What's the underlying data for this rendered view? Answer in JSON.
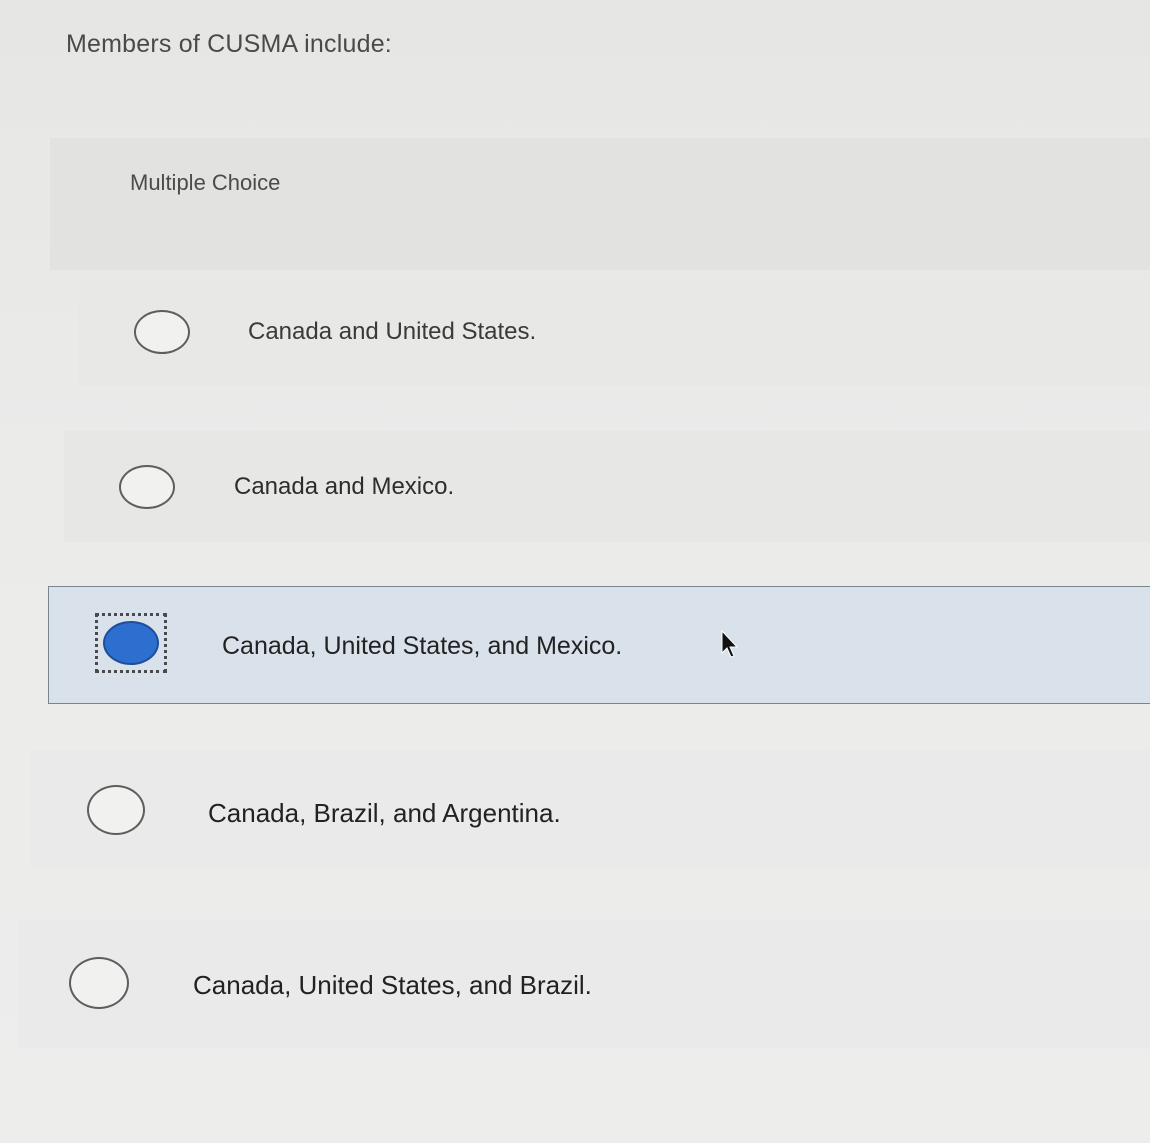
{
  "question": {
    "text": "Members of CUSMA include:"
  },
  "question_type": {
    "label": "Multiple Choice"
  },
  "options": [
    {
      "text": "Canada and United States.",
      "selected": false
    },
    {
      "text": "Canada and Mexico.",
      "selected": false
    },
    {
      "text": "Canada, United States, and Mexico.",
      "selected": true
    },
    {
      "text": "Canada, Brazil, and Argentina.",
      "selected": false
    },
    {
      "text": "Canada, United States, and Brazil.",
      "selected": false
    }
  ],
  "colors": {
    "selected_radio": "#2c6fce",
    "selected_row": "#d9e1ea"
  },
  "icons": {
    "cursor": "mouse-pointer-icon",
    "radio_empty": "radio-unchecked-icon",
    "radio_filled": "radio-checked-icon"
  }
}
